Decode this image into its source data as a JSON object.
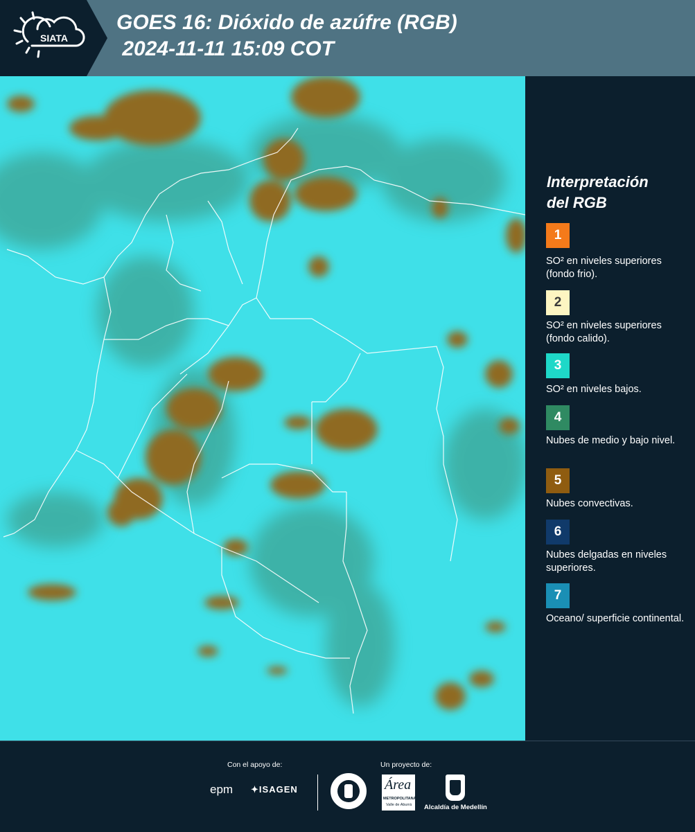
{
  "header": {
    "logo_text": "SIATA",
    "title_line1": "GOES 16: Dióxido de azúfre (RGB)",
    "title_line2": " 2024-11-11 15:09 COT"
  },
  "legend": {
    "title_line1": "Interpretación",
    "title_line2": "del RGB",
    "items": [
      {
        "number": "1",
        "color": "#f47a1a",
        "text_color": "#ffffff",
        "description": "SO² en niveles superiores (fondo frio)."
      },
      {
        "number": "2",
        "color": "#fdf5c2",
        "text_color": "#3a3a3a",
        "description": "SO² en niveles superiores (fondo calido)."
      },
      {
        "number": "3",
        "color": "#1ed8c8",
        "text_color": "#ffffff",
        "description": "SO² en niveles bajos."
      },
      {
        "number": "4",
        "color": "#2f8a62",
        "text_color": "#ffffff",
        "description": "Nubes de medio y bajo nivel."
      },
      {
        "number": "5",
        "color": "#8f5c10",
        "text_color": "#ffffff",
        "description": "Nubes convectivas."
      },
      {
        "number": "6",
        "color": "#103a6a",
        "text_color": "#ffffff",
        "description": "Nubes delgadas en niveles superiores."
      },
      {
        "number": "7",
        "color": "#1a8fb5",
        "text_color": "#ffffff",
        "description": "Oceano/ superficie continental."
      }
    ]
  },
  "footer": {
    "support_label": "Con el apoyo de:",
    "project_label": "Un proyecto de:",
    "logo_epm": "epm",
    "logo_isagen": "ISAGEN",
    "logo_metro_line1": "METROPOLITANA",
    "logo_metro_line2": "Valle de Aburrá",
    "logo_alcaldia": "Alcaldía de Medellín"
  },
  "colors": {
    "background": "#0c1f2d",
    "header": "#4f7383",
    "map_background": "#3fe0e8",
    "cloud_convective": "#8f6a22",
    "cloud_low": "#3c8e74"
  }
}
